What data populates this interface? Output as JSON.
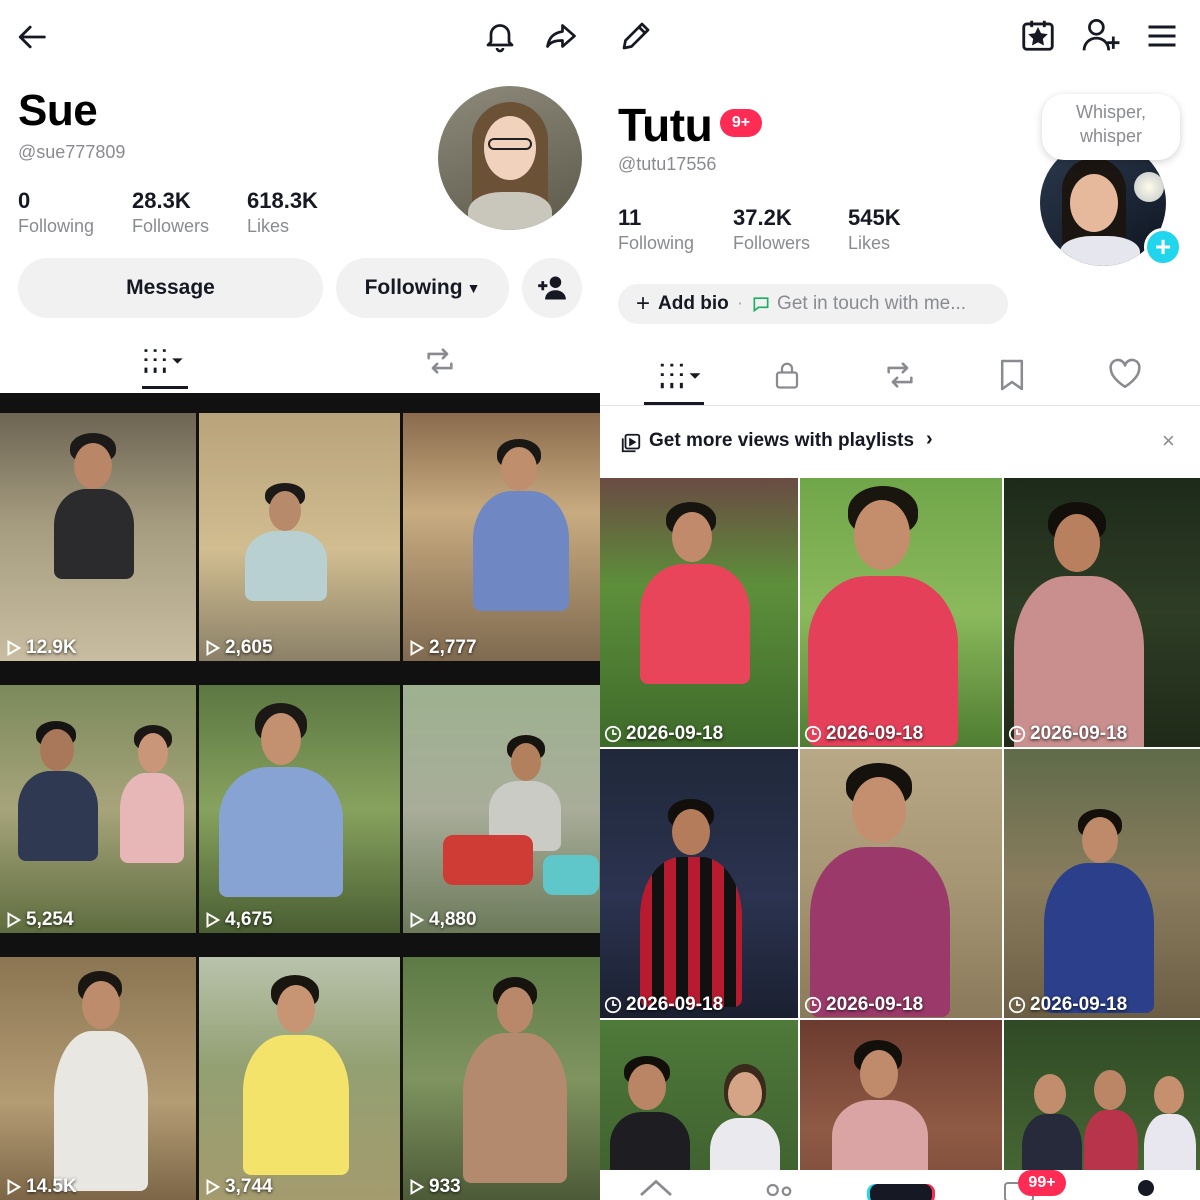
{
  "left": {
    "name": "Sue",
    "handle": "@sue777809",
    "stats": [
      {
        "value": "0",
        "label": "Following"
      },
      {
        "value": "28.3K",
        "label": "Followers"
      },
      {
        "value": "618.3K",
        "label": "Likes"
      }
    ],
    "message_label": "Message",
    "following_label": "Following",
    "icons": {
      "back": "arrow-left-icon",
      "bell": "bell-icon",
      "share": "share-icon",
      "add_friend": "add-friend-icon",
      "grid": "grid-icon",
      "repost": "repost-icon"
    },
    "videos": [
      {
        "views": "12.9K"
      },
      {
        "views": "2,605"
      },
      {
        "views": "2,777"
      },
      {
        "views": "5,254"
      },
      {
        "views": "4,675"
      },
      {
        "views": "4,880"
      },
      {
        "views": "14.5K"
      },
      {
        "views": "3,744"
      },
      {
        "views": "933"
      }
    ]
  },
  "right": {
    "name": "Tutu",
    "name_badge": "9+",
    "handle": "@tutu17556",
    "stats": [
      {
        "value": "11",
        "label": "Following"
      },
      {
        "value": "37.2K",
        "label": "Followers"
      },
      {
        "value": "545K",
        "label": "Likes"
      }
    ],
    "bubble_text": "Whisper, whisper",
    "add_bio": "Add bio",
    "get_in_touch": "Get in touch with me...",
    "playlist_prompt": "Get more views with playlists",
    "nav_badge": "99+",
    "icons": {
      "edit": "pencil-icon",
      "calendar": "calendar-star-icon",
      "add_user": "add-user-icon",
      "menu": "menu-icon",
      "lock": "lock-icon",
      "bookmark": "bookmark-icon",
      "heart": "heart-icon",
      "close": "close-icon"
    },
    "videos": [
      {
        "date": "2026-09-18"
      },
      {
        "date": "2026-09-18"
      },
      {
        "date": "2026-09-18"
      },
      {
        "date": "2026-09-18"
      },
      {
        "date": "2026-09-18"
      },
      {
        "date": "2026-09-18"
      },
      {
        "date": ""
      },
      {
        "date": ""
      },
      {
        "date": ""
      }
    ]
  },
  "colors": {
    "accent": "#fe2c55",
    "cyan": "#20d5ec",
    "muted": "#8a8b91",
    "pill": "#f1f1f2"
  }
}
